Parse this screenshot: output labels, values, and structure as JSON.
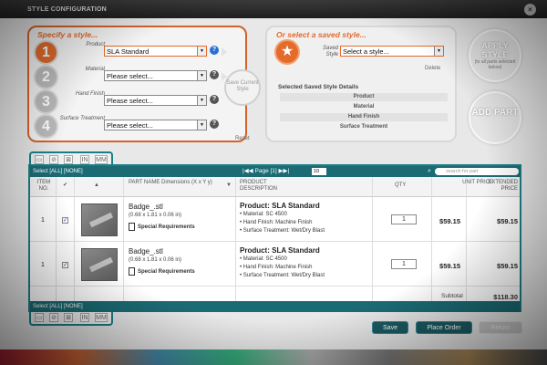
{
  "window": {
    "title": "STYLE CONFIGURATION",
    "close_label": "×"
  },
  "specify": {
    "heading": "Specify a style...",
    "steps": [
      {
        "num": "1",
        "label": "Product",
        "value": "SLA Standard"
      },
      {
        "num": "2",
        "label": "Material",
        "value": "Please select..."
      },
      {
        "num": "3",
        "label": "Hand Finish",
        "value": "Please select..."
      },
      {
        "num": "4",
        "label": "Surface Treatment",
        "value": "Please select..."
      }
    ],
    "help": "?",
    "save_current": "Save Current Style",
    "reset": "Reset"
  },
  "saved": {
    "heading": "Or select a saved style...",
    "saved_style_label": "Saved Style",
    "select_value": "Select a style...",
    "delete": "Delete",
    "details_title": "Selected Saved Style Details",
    "details_rows": [
      "Product",
      "Material",
      "Hand Finish",
      "Surface Treatment"
    ]
  },
  "actions": {
    "apply_style": "APPLY STYLE",
    "apply_note": "(to all parts selected below)",
    "add_part": "ADD PART"
  },
  "toolbar": {
    "icons": [
      "select-icon",
      "clear-icon",
      "delete-icon",
      "inches-icon",
      "millimeters-icon"
    ],
    "in_label": "IN",
    "mm_label": "MM"
  },
  "grid": {
    "select_label": "Select [ALL] [NONE]",
    "page_label": "Page",
    "page_num": "[1]",
    "per_page": "10",
    "search_placeholder": "search for part",
    "headers": {
      "item": "ITEM NO.",
      "part": "PART NAME Dimensions (X x Y y)",
      "product": "PRODUCT DESCRIPTION",
      "qty": "QTY",
      "unit": "UNIT PRICE",
      "extended": "EXTENDED PRICE"
    },
    "rows": [
      {
        "item": "1",
        "name": "Badge_.stl",
        "dims": "(0.68 x 1.81 x 0.06 in)",
        "req": "Special Requirements",
        "product": "Product: SLA Standard",
        "material": "• Material: SC 4500",
        "finish": "• Hand Finish: Machine Finish",
        "surface": "• Surface Treatment: Wet/Dry Blast",
        "qty": "1",
        "unit": "$59.15",
        "extended": "$59.15"
      },
      {
        "item": "1",
        "name": "Badge_.stl",
        "dims": "(0.68 x 1.81 x 0.06 in)",
        "req": "Special Requirements",
        "product": "Product: SLA Standard",
        "material": "• Material: SC 4500",
        "finish": "• Hand Finish: Machine Finish",
        "surface": "• Surface Treatment: Wet/Dry Blast",
        "qty": "1",
        "unit": "$59.15",
        "extended": "$59.15"
      }
    ],
    "subtotal_label": "Subtotal",
    "subtotal_value": "$118.30"
  },
  "footer": {
    "save": "Save",
    "place_order": "Place Order",
    "return": "Return"
  },
  "colors": {
    "accent": "#e36b2c",
    "teal": "#1b6b74"
  }
}
